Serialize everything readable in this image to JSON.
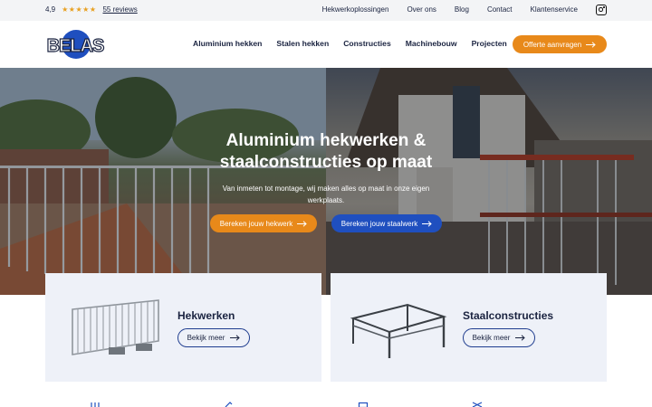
{
  "topbar": {
    "rating_score": "4,9",
    "reviews_label": "55 reviews",
    "links": [
      "Hekwerkoplossingen",
      "Over ons",
      "Blog",
      "Contact",
      "Klantenservice"
    ]
  },
  "header": {
    "logo_text": "BELAS",
    "nav": [
      "Aluminium hekken",
      "Stalen hekken",
      "Constructies",
      "Machinebouw",
      "Projecten"
    ],
    "cta_label": "Offerte aanvragen"
  },
  "hero": {
    "title_line1": "Aluminium hekwerken &",
    "title_line2": "staalconstructies op maat",
    "subtitle": "Van inmeten tot montage, wij maken alles op maat in onze eigen werkplaats.",
    "button_primary": "Bereken jouw hekwerk",
    "button_secondary": "Bereken jouw staalwerk"
  },
  "cards": [
    {
      "title": "Hekwerken",
      "button": "Bekijk meer"
    },
    {
      "title": "Staalconstructies",
      "button": "Bekijk meer"
    }
  ],
  "colors": {
    "accent_orange": "#e8891a",
    "brand_blue": "#1f4fbf",
    "navy_text": "#1a2340",
    "card_bg": "#eef1f8",
    "star": "#e8a020"
  },
  "icons": [
    "star-icon",
    "instagram-icon",
    "arrow-right-icon"
  ]
}
